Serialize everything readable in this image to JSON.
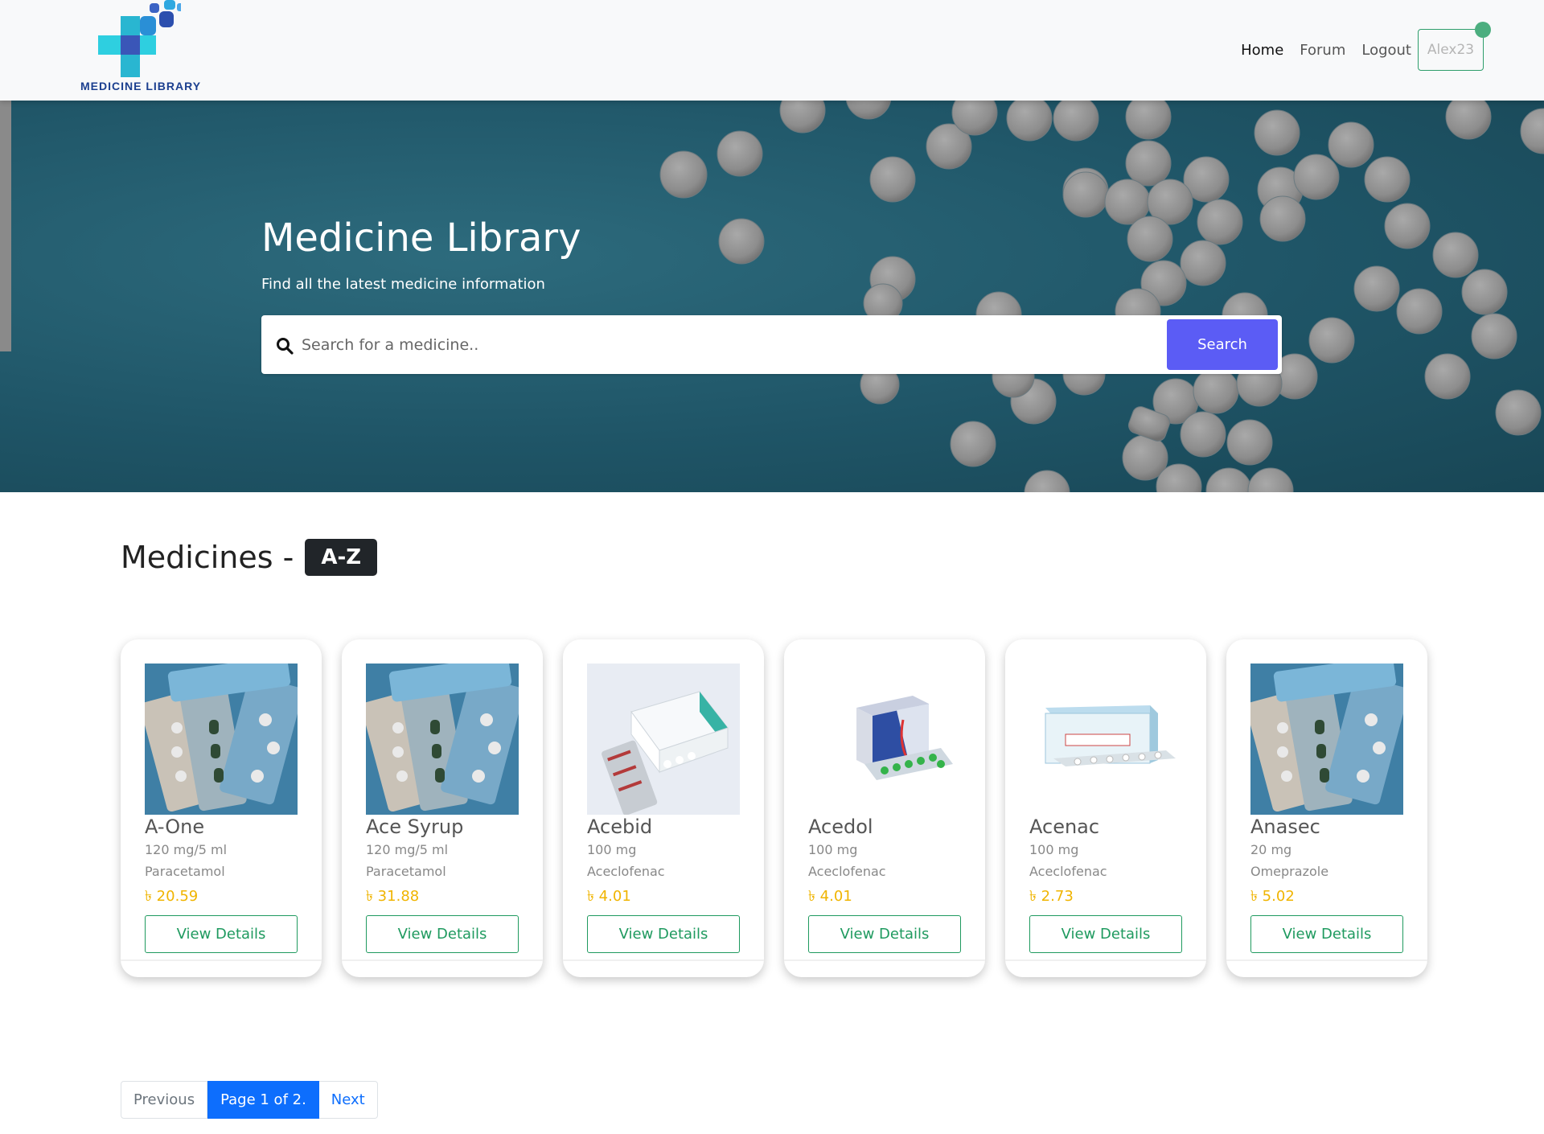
{
  "brand": {
    "logo_text": "MEDICINE LIBRARY"
  },
  "nav": {
    "items": [
      {
        "label": "Home",
        "active": true
      },
      {
        "label": "Forum",
        "active": false
      },
      {
        "label": "Logout",
        "active": false
      }
    ],
    "user": "Alex23"
  },
  "hero": {
    "title": "Medicine Library",
    "subtitle": "Find all the latest medicine information",
    "search_placeholder": "Search for a medicine..",
    "search_button": "Search"
  },
  "section": {
    "title": "Medicines -",
    "badge": "A-Z"
  },
  "medicines": [
    {
      "name": "A-One",
      "strength": "120 mg/5 ml",
      "generic": "Paracetamol",
      "price": "৳ 20.59",
      "button": "View Details",
      "image": "blister-photo"
    },
    {
      "name": "Ace Syrup",
      "strength": "120 mg/5 ml",
      "generic": "Paracetamol",
      "price": "৳ 31.88",
      "button": "View Details",
      "image": "blister-photo"
    },
    {
      "name": "Acebid",
      "strength": "100 mg",
      "generic": "Aceclofenac",
      "price": "৳ 4.01",
      "button": "View Details",
      "image": "acebid-box"
    },
    {
      "name": "Acedol",
      "strength": "100 mg",
      "generic": "Aceclofenac",
      "price": "৳ 4.01",
      "button": "View Details",
      "image": "acedol-box"
    },
    {
      "name": "Acenac",
      "strength": "100 mg",
      "generic": "Aceclofenac",
      "price": "৳ 2.73",
      "button": "View Details",
      "image": "acenac-box"
    },
    {
      "name": "Anasec",
      "strength": "20 mg",
      "generic": "Omeprazole",
      "price": "৳ 5.02",
      "button": "View Details",
      "image": "blister-photo"
    }
  ],
  "pagination": {
    "previous": "Previous",
    "current": "Page 1 of 2.",
    "next": "Next"
  },
  "colors": {
    "primary": "#0d6efd",
    "search": "#5b5cf5",
    "success": "#1f9a5f",
    "price": "#f0b400",
    "hero": "#1f5567"
  }
}
